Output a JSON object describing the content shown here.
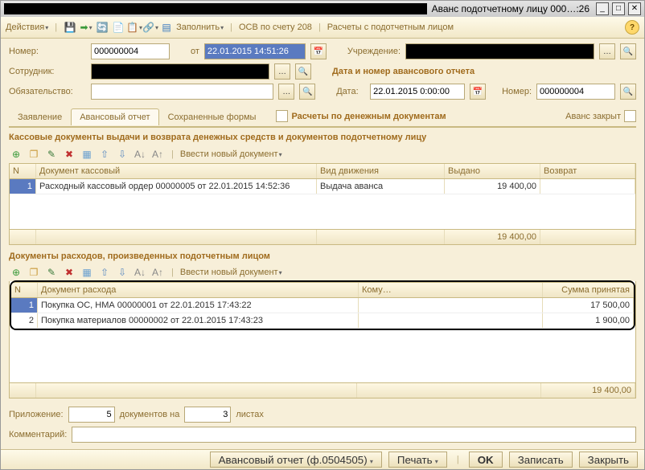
{
  "window": {
    "title": "Аванс подотчетному лицу 000…:26"
  },
  "toolbar": {
    "actions": "Действия",
    "fill": "Заполнить",
    "osv": "ОСВ по счету 208",
    "calc": "Расчеты с подотчетным лицом"
  },
  "header": {
    "labels": {
      "number": "Номер:",
      "from": "от",
      "institution": "Учреждение:",
      "employee": "Сотрудник:",
      "obligation": "Обязательство:",
      "report_section": "Дата и номер авансового отчета",
      "date": "Дата:",
      "rnum": "Номер:"
    },
    "values": {
      "number": "000000004",
      "datetime": "22.01.2015 14:51:26",
      "report_date": "22.01.2015 0:00:00",
      "report_number": "000000004"
    }
  },
  "tabs": {
    "app": "Заявление",
    "advance": "Авансовый отчет",
    "saved": "Сохраненные формы",
    "money_docs": "Расчеты по денежным документам",
    "advance_closed": "Аванс закрыт"
  },
  "section1": {
    "title": "Кассовые документы выдачи и возврата денежных средств и документов подотчетному лицу",
    "new_doc": "Ввести новый документ",
    "cols": {
      "n": "N",
      "doc": "Документ кассовый",
      "move": "Вид движения",
      "out": "Выдано",
      "ret": "Возврат"
    },
    "rows": [
      {
        "n": "1",
        "doc": "Расходный кассовый ордер 00000005 от 22.01.2015 14:52:36",
        "move": "Выдача аванса",
        "out": "19 400,00",
        "ret": ""
      }
    ],
    "total_out": "19 400,00"
  },
  "section2": {
    "title": "Документы расходов, произведенных подотчетным лицом",
    "new_doc": "Ввести новый документ",
    "cols": {
      "n": "N",
      "doc": "Документ расхода",
      "whom": "Кому…",
      "sum": "Сумма принятая"
    },
    "rows": [
      {
        "n": "1",
        "doc": "Покупка ОС, НМА 00000001 от 22.01.2015 17:43:22",
        "whom": "",
        "sum": "17 500,00"
      },
      {
        "n": "2",
        "doc": "Покупка материалов 00000002 от 22.01.2015 17:43:23",
        "whom": "",
        "sum": "1 900,00"
      }
    ],
    "total_sum": "19 400,00"
  },
  "bottom": {
    "attach_label": "Приложение:",
    "attach_count": "5",
    "docs_on": "документов на",
    "sheets": "3",
    "sheets_label": "листах",
    "comment": "Комментарий:"
  },
  "status": {
    "form": "Авансовый отчет (ф.0504505)",
    "print": "Печать",
    "ok": "OK",
    "save": "Записать",
    "close": "Закрыть"
  }
}
